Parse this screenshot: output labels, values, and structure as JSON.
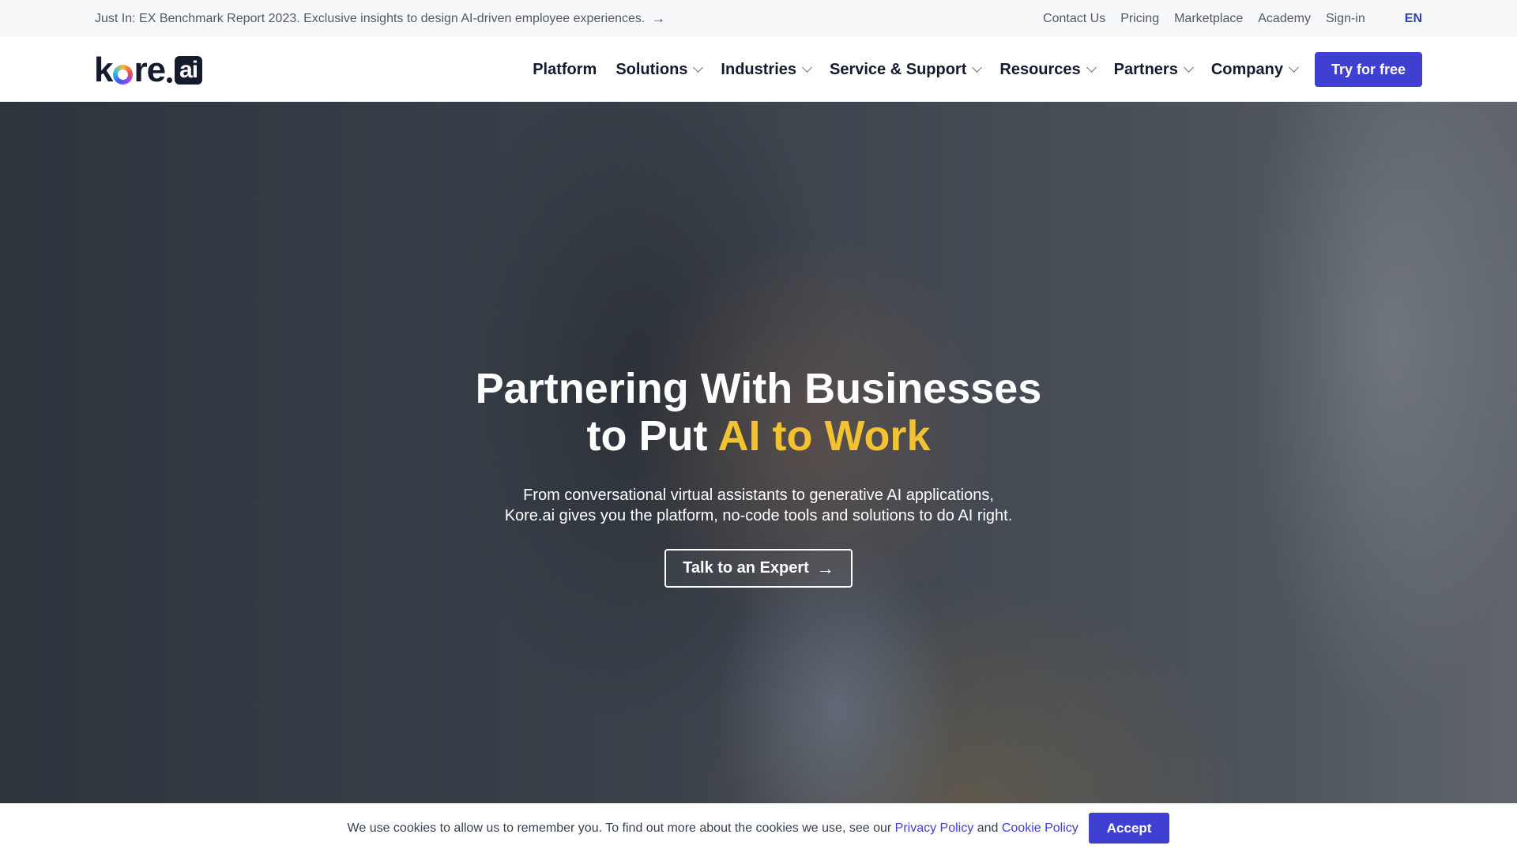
{
  "topbar": {
    "announcement": "Just In: EX Benchmark Report 2023. Exclusive insights to design AI-driven employee experiences.",
    "announcement_icon": "arrow-right-icon",
    "links": [
      "Contact Us",
      "Pricing",
      "Marketplace",
      "Academy",
      "Sign-in"
    ],
    "language": "EN"
  },
  "nav": {
    "logo_text": "kore",
    "logo_suffix": "ai",
    "items": [
      {
        "label": "Platform",
        "dropdown": false
      },
      {
        "label": "Solutions",
        "dropdown": true
      },
      {
        "label": "Industries",
        "dropdown": true
      },
      {
        "label": "Service & Support",
        "dropdown": true
      },
      {
        "label": "Resources",
        "dropdown": true
      },
      {
        "label": "Partners",
        "dropdown": true
      },
      {
        "label": "Company",
        "dropdown": true
      }
    ],
    "cta_label": "Try for free"
  },
  "hero": {
    "title_line1": "Partnering With Businesses",
    "title_line2_prefix": "to Put ",
    "title_line2_highlight": "AI to Work",
    "subtitle_line1": "From conversational virtual assistants to generative AI applications,",
    "subtitle_line2": "Kore.ai gives you the platform, no-code tools and solutions to do AI right.",
    "button_label": "Talk to an Expert",
    "button_icon": "arrow-right-icon"
  },
  "cookie": {
    "text": "We use cookies to allow us to remember you. To find out more about the cookies we use, see our",
    "privacy_link": "Privacy Policy",
    "conjunction": "and",
    "cookie_link": "Cookie Policy",
    "accept_label": "Accept"
  },
  "colors": {
    "brand": "#3f3fd1",
    "highlight": "#f2c230",
    "text_dark": "#141b2d"
  }
}
